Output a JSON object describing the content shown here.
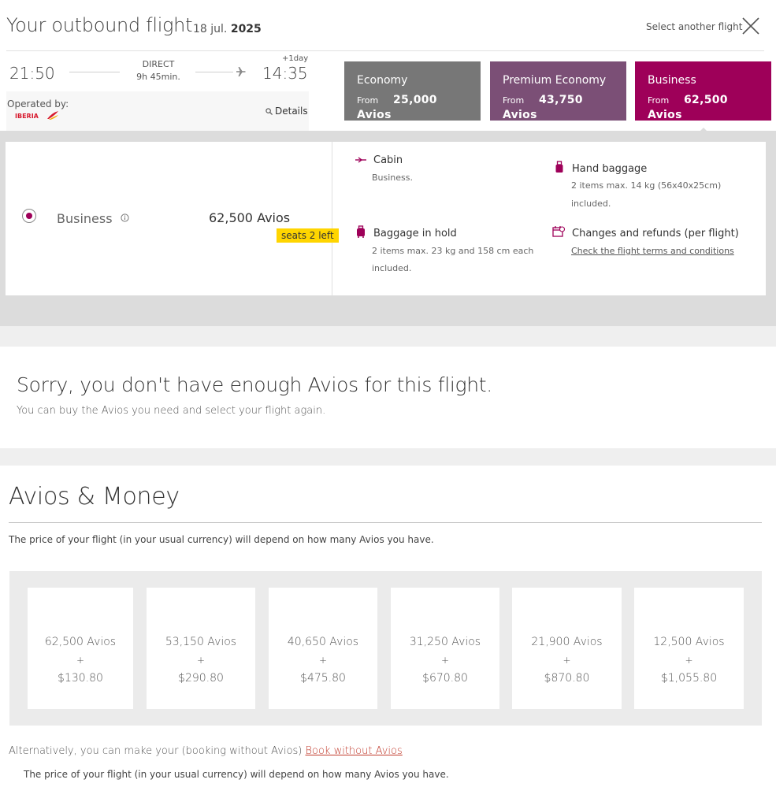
{
  "header": {
    "title": "Your outbound flight",
    "date_day": "18 jul.",
    "date_year": "2025",
    "select_another": "Select another flight"
  },
  "flight": {
    "departure_time": "21:50",
    "arrival_time": "14:35",
    "stops": "DIRECT",
    "duration": "9h 45min.",
    "day_offset": "+1day",
    "operated_by_label": "Operated by:",
    "operator": "IBERIA",
    "details_label": "Details"
  },
  "cabin_tabs": [
    {
      "name": "Economy",
      "from_label": "From",
      "price": "25,000 Avios",
      "color": "#777777"
    },
    {
      "name": "Premium Economy",
      "from_label": "From",
      "price": "43,750 Avios",
      "color": "#7b4f76"
    },
    {
      "name": "Business",
      "from_label": "From",
      "price": "62,500 Avios",
      "color": "#9e0059"
    }
  ],
  "fare": {
    "name": "Business",
    "price": "62,500 Avios",
    "seats_left": "seats 2 left",
    "features": {
      "cabin": {
        "title": "Cabin",
        "text": "Business."
      },
      "hand_baggage": {
        "title": "Hand baggage",
        "text1": "2 items max. 14 kg (56x40x25cm)",
        "text2": "included."
      },
      "hold_baggage": {
        "title": "Baggage in hold",
        "text1": "2 items max. 23 kg and 158 cm each",
        "text2": "included."
      },
      "changes": {
        "title": "Changes and refunds (per flight)",
        "link": "Check the flight terms and conditions"
      }
    }
  },
  "sorry": {
    "title": "Sorry, you don't have enough Avios for this flight.",
    "subtitle": "You can buy the Avios you need and select your flight again."
  },
  "avios_money": {
    "title": "Avios & Money",
    "description": "The price of your flight (in your usual currency) will depend on how many Avios you have.",
    "options": [
      {
        "avios": "62,500 Avios",
        "plus": "+",
        "money": "$130.80"
      },
      {
        "avios": "53,150 Avios",
        "plus": "+",
        "money": "$290.80"
      },
      {
        "avios": "40,650 Avios",
        "plus": "+",
        "money": "$475.80"
      },
      {
        "avios": "31,250 Avios",
        "plus": "+",
        "money": "$670.80"
      },
      {
        "avios": "21,900 Avios",
        "plus": "+",
        "money": "$870.80"
      },
      {
        "avios": "12,500 Avios",
        "plus": "+",
        "money": "$1,055.80"
      }
    ],
    "alternative_text": "Alternatively, you can make your (booking without Avios)",
    "alternative_link": "Book without Avios",
    "footer_note": "The price of your flight (in your usual currency) will depend on how many Avios you have."
  },
  "colors": {
    "brand": "#9e0059",
    "badge": "#ffd500",
    "link": "#c0392b"
  }
}
